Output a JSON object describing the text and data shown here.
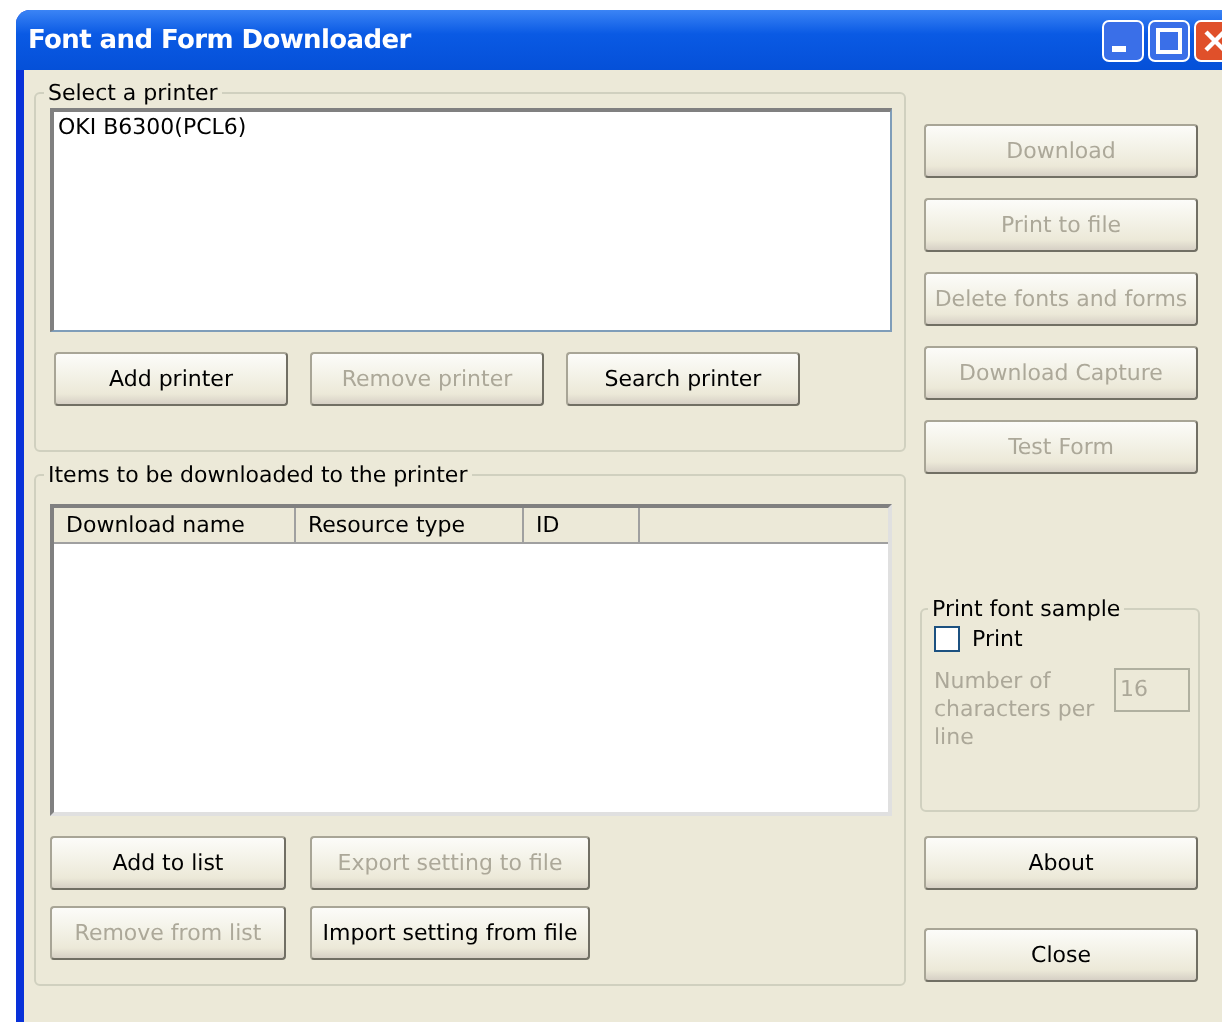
{
  "window": {
    "title": "Font and Form Downloader"
  },
  "printer_group": {
    "label": "Select a printer",
    "printers": [
      {
        "name": "OKI B6300(PCL6)",
        "selected": false
      }
    ],
    "buttons": [
      {
        "label": "Add printer",
        "disabled": false
      },
      {
        "label": "Remove printer",
        "disabled": true
      },
      {
        "label": "Search printer",
        "disabled": false
      }
    ]
  },
  "items_group": {
    "label": "Items to be downloaded to the printer",
    "columns": [
      "Download name",
      "Resource type",
      "ID"
    ],
    "buttons": [
      {
        "label": "Add to list",
        "disabled": false
      },
      {
        "label": "Export setting to file",
        "disabled": true
      },
      {
        "label": "Remove from list",
        "disabled": true
      },
      {
        "label": "Import setting from file",
        "disabled": false
      }
    ]
  },
  "side_buttons": [
    {
      "label": "Download",
      "disabled": true
    },
    {
      "label": "Print to file",
      "disabled": true
    },
    {
      "label": "Delete fonts and forms",
      "disabled": true
    },
    {
      "label": "Download Capture",
      "disabled": true
    },
    {
      "label": "Test Form",
      "disabled": true
    }
  ],
  "font_sample": {
    "label": "Print font sample",
    "checkbox": {
      "label": "Print",
      "checked": false
    },
    "chars_label": "Number of characters per line",
    "chars_value": "16",
    "disabled": true
  },
  "bottom_buttons": [
    {
      "label": "About",
      "disabled": false
    },
    {
      "label": "Close",
      "disabled": false
    }
  ]
}
